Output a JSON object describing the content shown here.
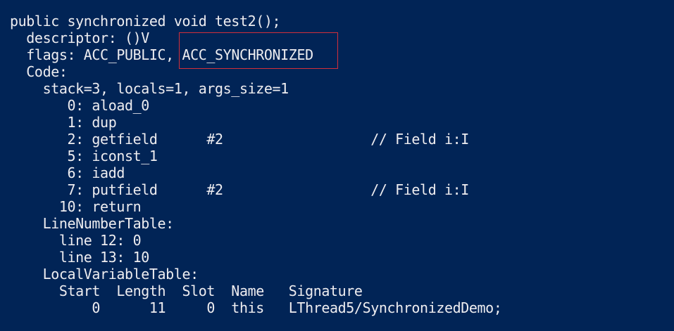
{
  "bytecode": {
    "method_signature": "public synchronized void test2();",
    "descriptor": "  descriptor: ()V",
    "flags_prefix": "  flags: ACC_PUBLIC, ",
    "flags_highlighted": "ACC_SYNCHRONIZED",
    "code_label": "  Code:",
    "stack_info": "    stack=3, locals=1, args_size=1",
    "instructions": [
      "       0: aload_0",
      "       1: dup",
      "       2: getfield      #2                  // Field i:I",
      "       5: iconst_1",
      "       6: iadd",
      "       7: putfield      #2                  // Field i:I",
      "      10: return"
    ],
    "line_number_table_label": "    LineNumberTable:",
    "line_numbers": [
      "      line 12: 0",
      "      line 13: 10"
    ],
    "local_variable_table_label": "    LocalVariableTable:",
    "local_variable_header": "      Start  Length  Slot  Name   Signature",
    "local_variable_row": "          0      11     0  this   LThread5/SynchronizedDemo;"
  },
  "colors": {
    "background": "#012456",
    "text": "#eeedf0",
    "highlight_border": "#d32f3a"
  }
}
